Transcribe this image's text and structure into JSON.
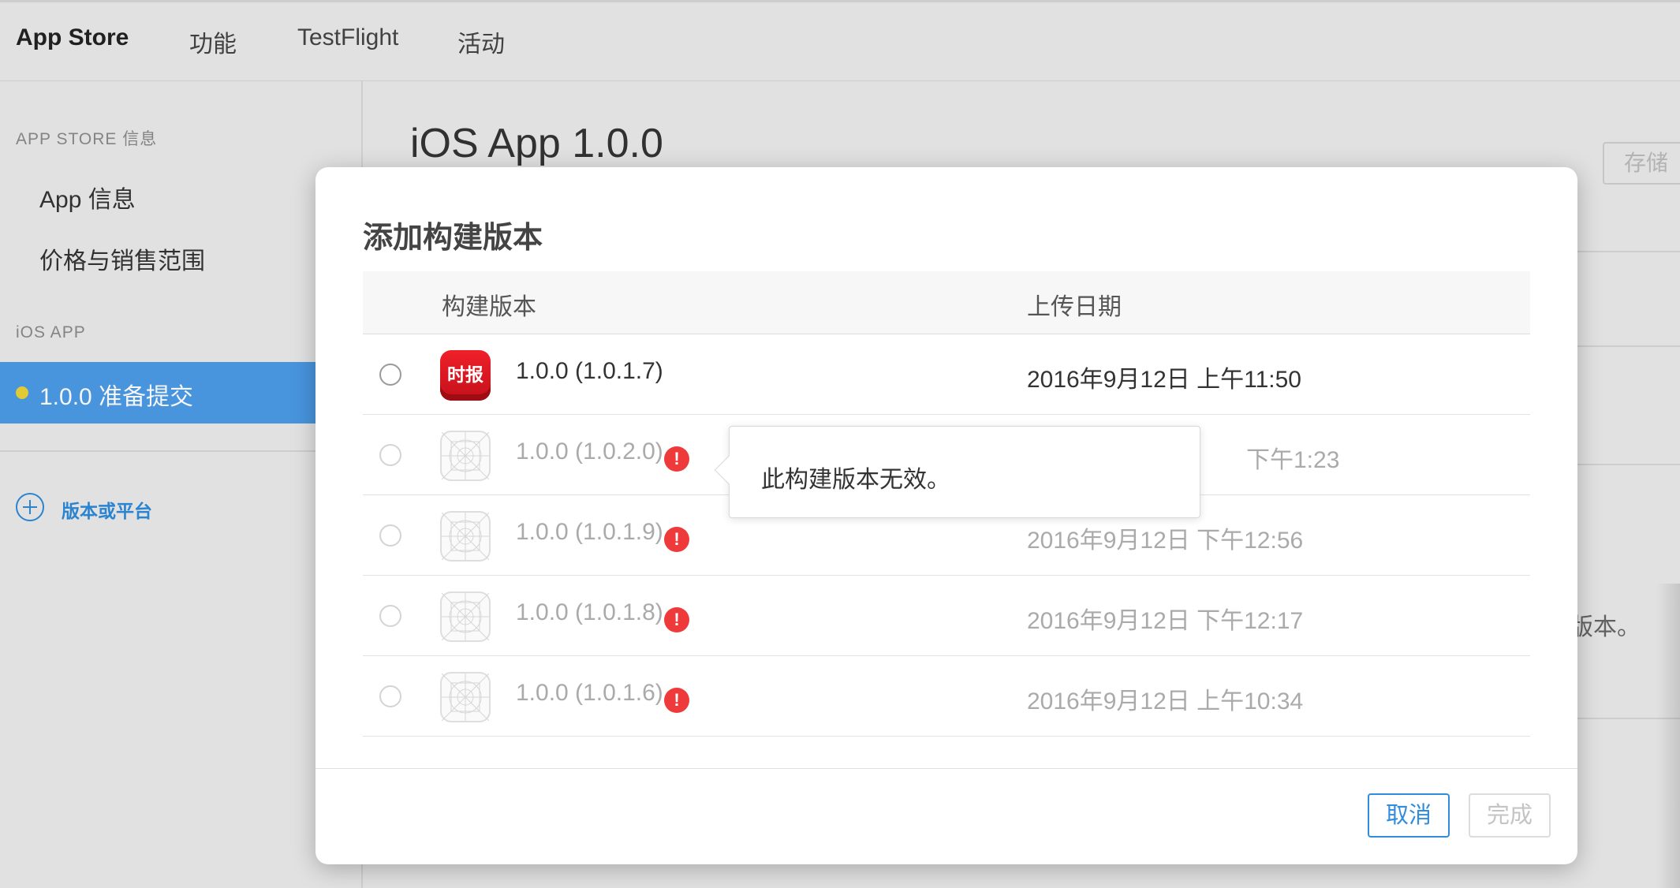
{
  "topnav": {
    "tabs": [
      {
        "label": "App Store",
        "active": true
      },
      {
        "label": "功能",
        "active": false
      },
      {
        "label": "TestFlight",
        "active": false
      },
      {
        "label": "活动",
        "active": false
      }
    ]
  },
  "sidebar": {
    "section_app_store": "APP STORE 信息",
    "app_info": "App 信息",
    "pricing": "价格与销售范围",
    "section_ios": "iOS APP",
    "selected_version": "1.0.0 准备提交",
    "status_color": "#ecd33a",
    "add_platform": "版本或平台"
  },
  "main": {
    "title": "iOS App 1.0.0",
    "save_label": "存储",
    "partial_text": "版本。"
  },
  "modal": {
    "title": "添加构建版本",
    "columns": {
      "build": "构建版本",
      "upload_date": "上传日期"
    },
    "rows": [
      {
        "build": "1.0.0 (1.0.1.7)",
        "date": "2016年9月12日 上午11:50",
        "valid": true,
        "icon": "app-icon-shibao",
        "icon_text": "时报"
      },
      {
        "build": "1.0.0 (1.0.2.0)",
        "date": "下午1:23",
        "valid": false,
        "icon": "placeholder-app-icon"
      },
      {
        "build": "1.0.0 (1.0.1.9)",
        "date": "2016年9月12日 下午12:56",
        "valid": false,
        "icon": "placeholder-app-icon"
      },
      {
        "build": "1.0.0 (1.0.1.8)",
        "date": "2016年9月12日 下午12:17",
        "valid": false,
        "icon": "placeholder-app-icon"
      },
      {
        "build": "1.0.0 (1.0.1.6)",
        "date": "2016年9月12日 上午10:34",
        "valid": false,
        "icon": "placeholder-app-icon"
      }
    ],
    "warning_glyph": "!",
    "tooltip": "此构建版本无效。",
    "cancel_label": "取消",
    "done_label": "完成",
    "accent_color": "#2f8ddb",
    "warning_color": "#ee3a3a"
  }
}
